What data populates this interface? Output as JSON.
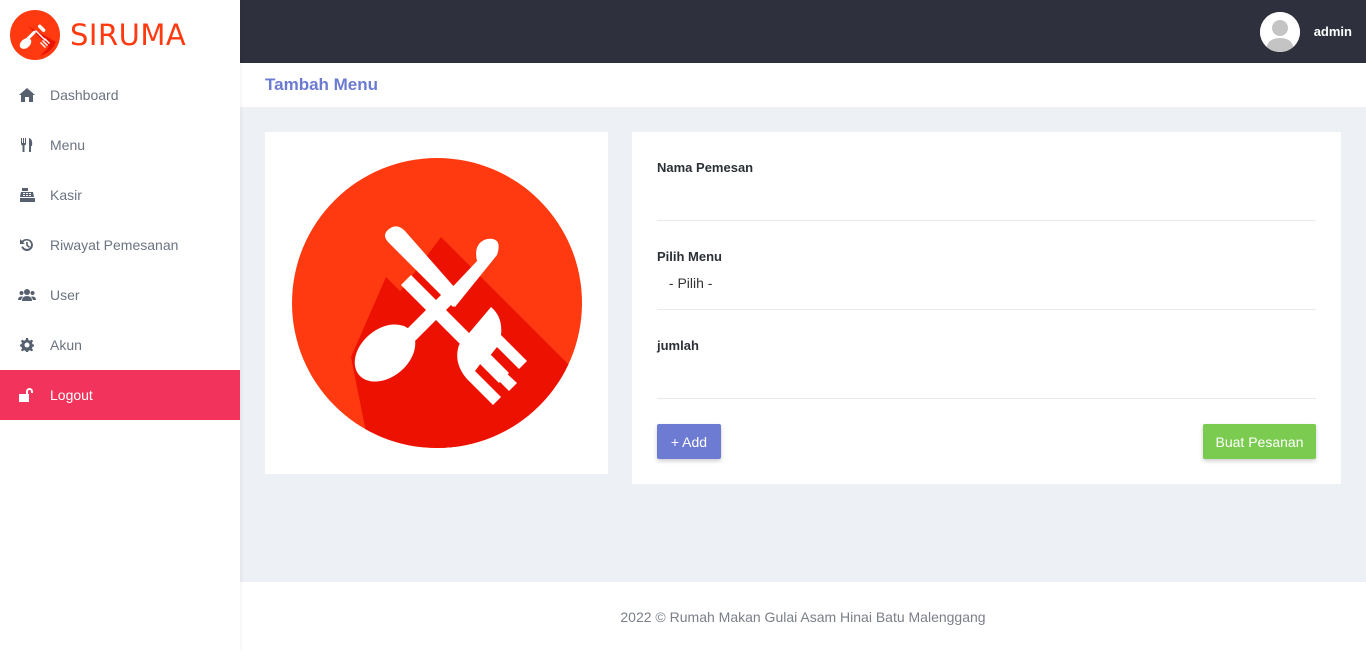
{
  "brand": {
    "name": "SIRUMA",
    "accent": "#ff3a10"
  },
  "sidebar": {
    "items": [
      {
        "label": "Dashboard",
        "icon": "home-icon"
      },
      {
        "label": "Menu",
        "icon": "utensils-icon"
      },
      {
        "label": "Kasir",
        "icon": "cash-register-icon"
      },
      {
        "label": "Riwayat Pemesanan",
        "icon": "history-icon"
      },
      {
        "label": "User",
        "icon": "users-icon"
      },
      {
        "label": "Akun",
        "icon": "gear-icon"
      },
      {
        "label": "Logout",
        "icon": "unlock-icon",
        "active": true
      }
    ],
    "active_color": "#f2335b"
  },
  "topbar": {
    "user_name": "admin",
    "background": "#2e303e"
  },
  "page": {
    "title": "Tambah Menu"
  },
  "form": {
    "nama_label": "Nama Pemesan",
    "nama_value": "",
    "menu_label": "Pilih Menu",
    "menu_selected": " - Pilih -",
    "jumlah_label": "jumlah",
    "jumlah_value": "",
    "add_label": "+ Add",
    "order_label": "Buat Pesanan"
  },
  "footer": {
    "text": "2022 © Rumah Makan Gulai Asam Hinai Batu Malenggang"
  }
}
